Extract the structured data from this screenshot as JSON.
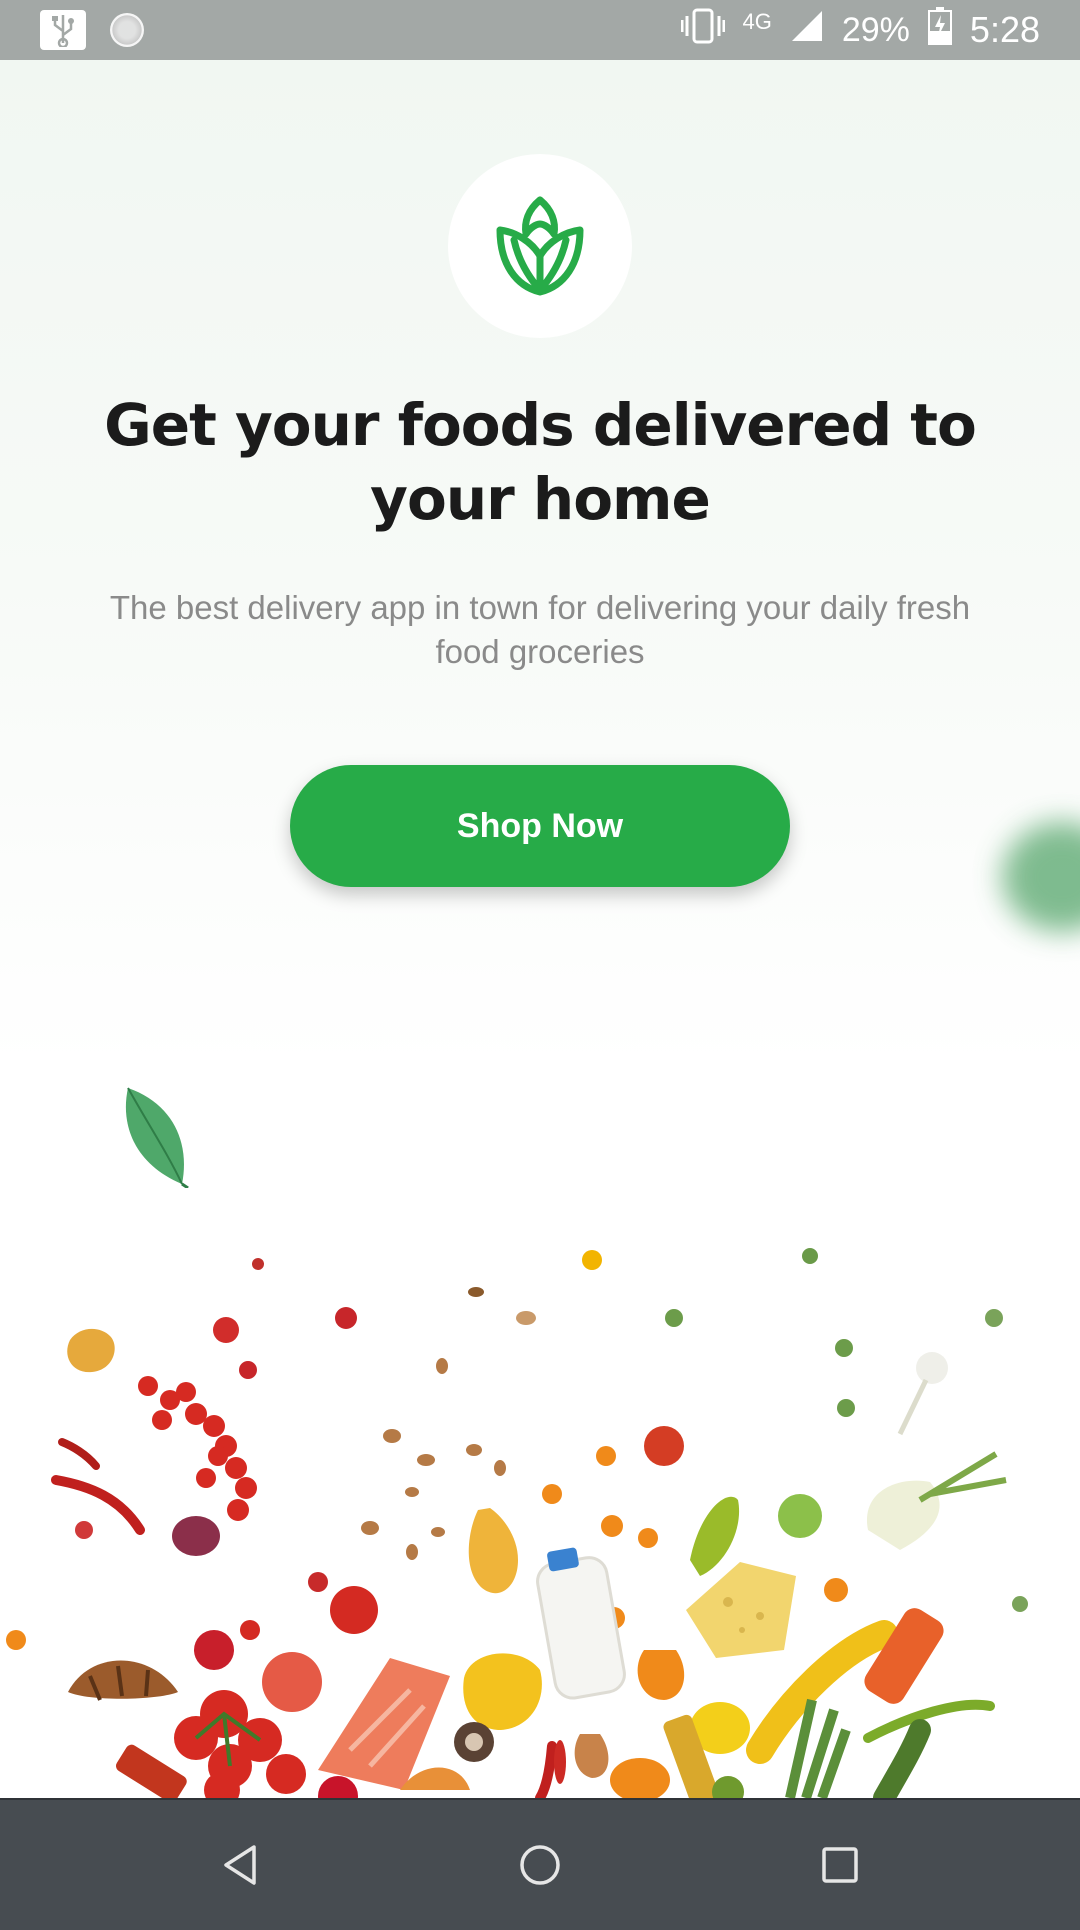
{
  "status_bar": {
    "left_icons": [
      "usb-icon",
      "loading-icon"
    ],
    "network": "4G",
    "battery_percent": "29%",
    "time": "5:28",
    "icons": [
      "vibrate-icon",
      "signal-icon",
      "battery-charging-icon"
    ]
  },
  "hero": {
    "logo_icon": "leaf-logo-icon",
    "headline": "Get your foods delivered to your home",
    "subtitle": "The best delivery app in town for delivering your daily fresh food groceries",
    "cta_label": "Shop Now"
  },
  "nav_bar": {
    "icons": [
      "back-icon",
      "home-icon",
      "recents-icon"
    ]
  },
  "colors": {
    "brand_green": "#27ab48",
    "status_bar": "#a3a8a6",
    "nav_bar": "#474c51",
    "headline": "#1b1b1b",
    "subtitle": "#8a8a8a"
  }
}
